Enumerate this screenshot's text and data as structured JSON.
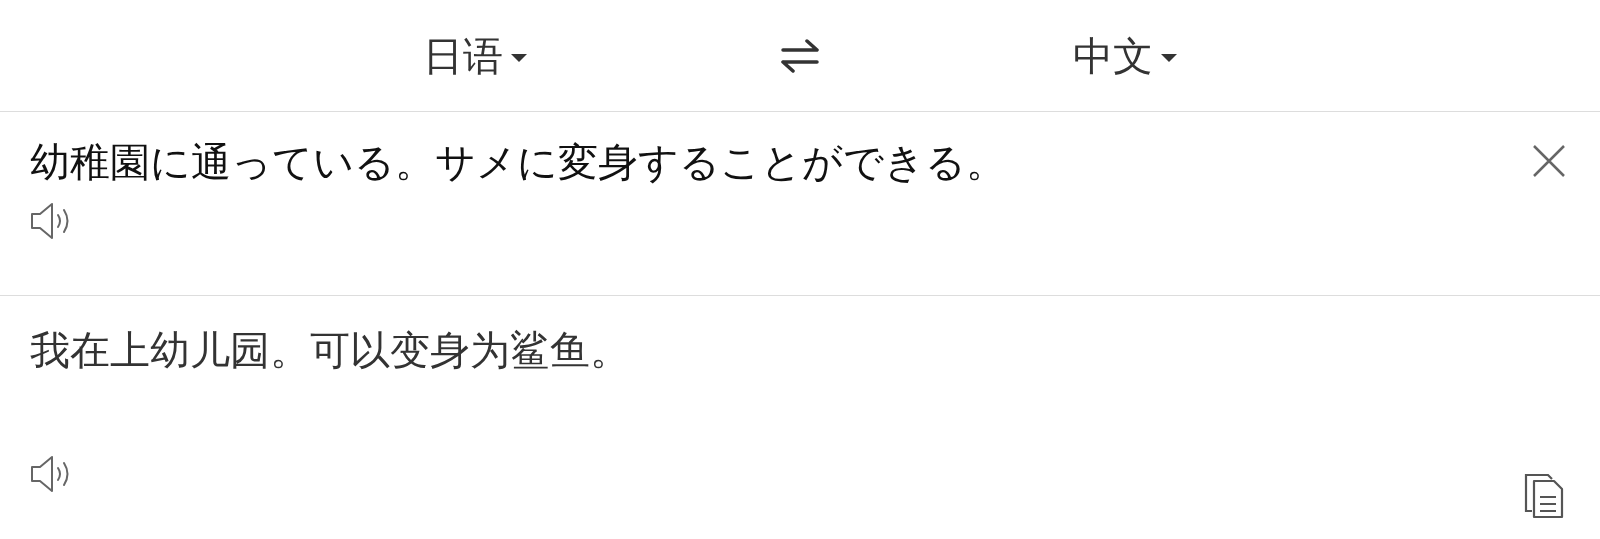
{
  "languages": {
    "source": "日语",
    "target": "中文"
  },
  "source": {
    "text": "幼稚園に通っている。サメに変身することができる。"
  },
  "translation": {
    "text": "我在上幼儿园。可以变身为鲨鱼。"
  }
}
